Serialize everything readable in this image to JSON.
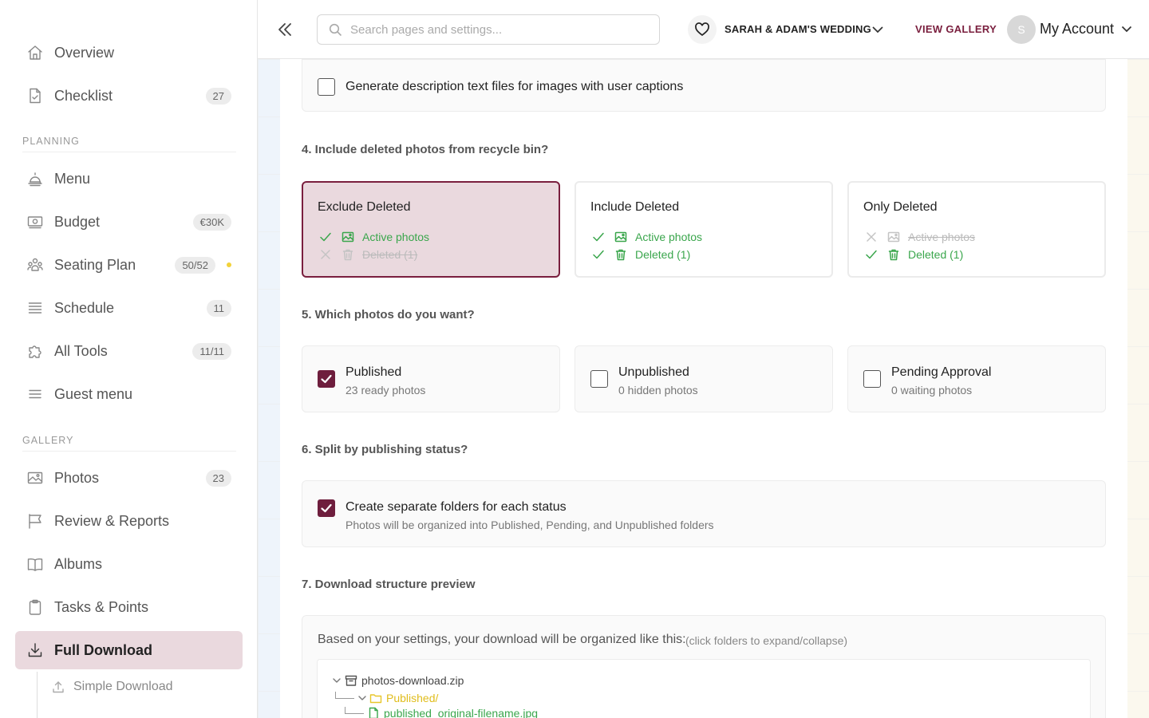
{
  "sidebar": {
    "items": [
      {
        "label": "Overview",
        "icon": "home-icon"
      },
      {
        "label": "Checklist",
        "icon": "checklist-icon",
        "badge": "27"
      },
      {
        "label": "Menu",
        "icon": "cloche-icon"
      },
      {
        "label": "Budget",
        "icon": "money-icon",
        "badge": "€30K"
      },
      {
        "label": "Seating Plan",
        "icon": "people-icon",
        "badge": "50/52"
      },
      {
        "label": "Schedule",
        "icon": "list-icon",
        "badge": "11"
      },
      {
        "label": "All Tools",
        "icon": "puzzle-icon",
        "badge": "11/11"
      },
      {
        "label": "Guest menu",
        "icon": "menu-lines-icon"
      },
      {
        "label": "Photos",
        "icon": "image-icon",
        "badge": "23"
      },
      {
        "label": "Review & Reports",
        "icon": "flag-icon"
      },
      {
        "label": "Albums",
        "icon": "book-icon"
      },
      {
        "label": "Tasks & Points",
        "icon": "clipboard-icon"
      },
      {
        "label": "Full Download",
        "icon": "download-icon"
      }
    ],
    "sections": {
      "planning": "PLANNING",
      "gallery": "GALLERY"
    },
    "sub_item": {
      "label": "Simple Download",
      "icon": "upload-icon"
    },
    "dot_color": "#f2d23a"
  },
  "header": {
    "search_placeholder": "Search pages and settings...",
    "event_name": "SARAH & ADAM'S WEDDING",
    "view_gallery": "VIEW GALLERY",
    "avatar_initial": "S",
    "account": "My Account"
  },
  "content": {
    "top_option": {
      "label": "Generate description text files for images with user captions",
      "checked": false
    },
    "q4": {
      "title": "4. Include deleted photos from recycle bin?",
      "options": [
        {
          "title": "Exclude Deleted",
          "selected": true,
          "rows": [
            {
              "label": "Active photos",
              "included": true
            },
            {
              "label": "Deleted (1)",
              "included": false
            }
          ]
        },
        {
          "title": "Include Deleted",
          "selected": false,
          "rows": [
            {
              "label": "Active photos",
              "included": true
            },
            {
              "label": "Deleted (1)",
              "included": true
            }
          ]
        },
        {
          "title": "Only Deleted",
          "selected": false,
          "rows": [
            {
              "label": "Active photos",
              "included": false
            },
            {
              "label": "Deleted (1)",
              "included": true
            }
          ]
        }
      ]
    },
    "q5": {
      "title": "5. Which photos do you want?",
      "options": [
        {
          "title": "Published",
          "sub": "23 ready photos",
          "checked": true
        },
        {
          "title": "Unpublished",
          "sub": "0 hidden photos",
          "checked": false
        },
        {
          "title": "Pending Approval",
          "sub": "0 waiting photos",
          "checked": false
        }
      ]
    },
    "q6": {
      "title": "6. Split by publishing status?",
      "option": {
        "title": "Create separate folders for each status",
        "sub": "Photos will be organized into Published, Pending, and Unpublished folders",
        "checked": true
      }
    },
    "q7": {
      "title": "7. Download structure preview",
      "intro": "Based on your settings, your download will be organized like this:",
      "hint": "(click folders to expand/collapse)",
      "tree": [
        "photos-download.zip",
        "Published/",
        "published_original-filename.jpg"
      ]
    },
    "accent": "#6e1e3d",
    "success": "#3aa64c",
    "folder_color": "#e8c62a"
  }
}
